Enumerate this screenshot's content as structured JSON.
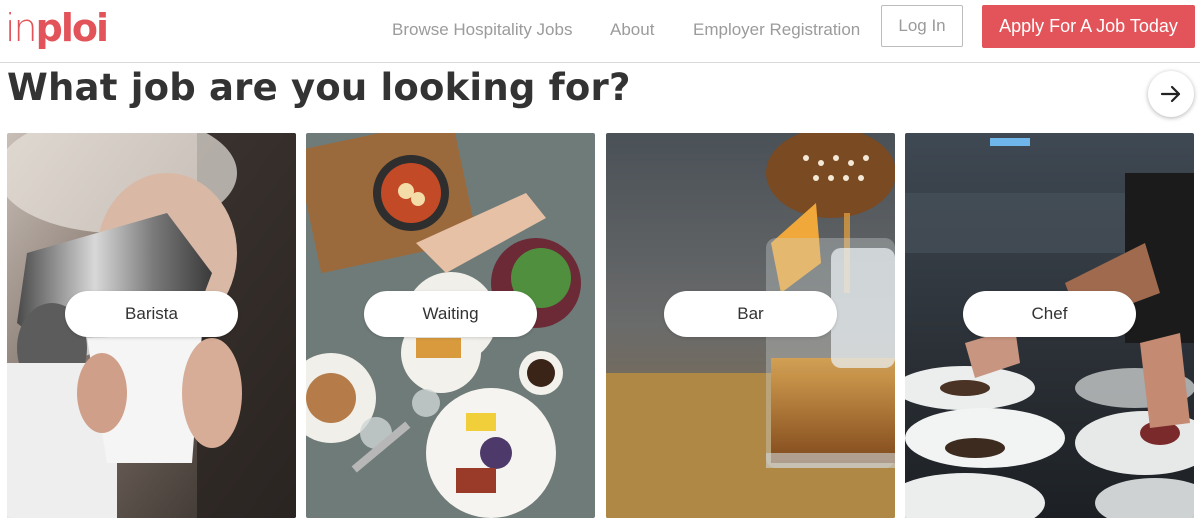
{
  "header": {
    "logo_in": "in",
    "logo_ploi": "ploi",
    "nav": {
      "browse": "Browse Hospitality Jobs",
      "about": "About",
      "employer": "Employer Registration"
    },
    "login": "Log In",
    "apply": "Apply For A Job Today"
  },
  "main": {
    "title": "What job are you looking for?",
    "next_icon": "arrow-right-icon",
    "categories": [
      {
        "label": "Barista"
      },
      {
        "label": "Waiting"
      },
      {
        "label": "Bar"
      },
      {
        "label": "Chef"
      }
    ]
  },
  "colors": {
    "brand": "#e2545a",
    "nav_text": "#9b9b9b",
    "title_text": "#333333"
  }
}
